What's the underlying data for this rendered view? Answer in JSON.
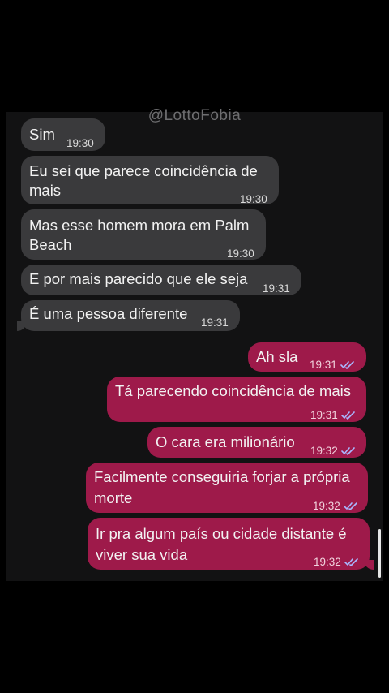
{
  "watermark": "@LottoFobia",
  "received": [
    {
      "text": "Sim",
      "time": "19:30"
    },
    {
      "text_line1": "Eu sei que parece coincidência de",
      "text_line2": "mais",
      "time": "19:30"
    },
    {
      "text_line1": "Mas esse homem mora em Palm",
      "text_line2": "Beach",
      "time": "19:30"
    },
    {
      "text": "E por mais parecido que ele seja",
      "time": "19:31"
    },
    {
      "text": "É uma pessoa diferente",
      "time": "19:31"
    }
  ],
  "sent": [
    {
      "text": "Ah sla",
      "time": "19:31"
    },
    {
      "text": "Tá parecendo coincidência de mais",
      "time": "19:31"
    },
    {
      "text": "O cara era milionário",
      "time": "19:32"
    },
    {
      "text_line1": "Facilmente conseguiria forjar a própria",
      "text_line2": "morte",
      "time": "19:32"
    },
    {
      "text_line1": "Ir pra algum país ou cidade distante é",
      "text_line2": "viver sua vida",
      "time": "19:32"
    }
  ],
  "colors": {
    "background": "#000000",
    "panel": "#121213",
    "received_bubble": "#3a3a3c",
    "sent_bubble": "#9e1a4a",
    "read_check": "#a9b8ff"
  },
  "icons": {
    "read_receipt": "double-check-icon"
  }
}
